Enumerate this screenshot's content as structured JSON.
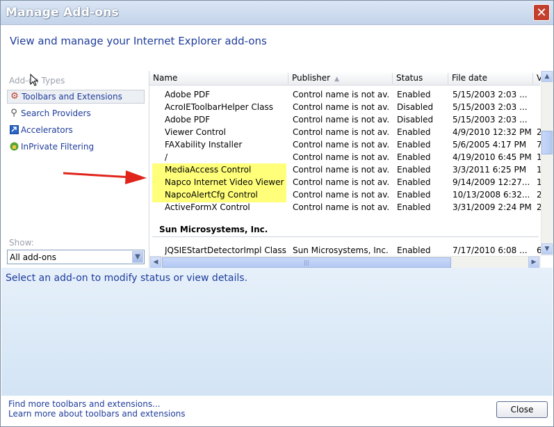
{
  "window": {
    "title": "Manage Add-ons",
    "close_glyph": "✕"
  },
  "header": {
    "heading": "View and manage your Internet Explorer add-ons"
  },
  "sidebar": {
    "types_label": "Add-on Types",
    "items": [
      {
        "label": "Toolbars and Extensions",
        "icon": "gear-icon",
        "selected": true
      },
      {
        "label": "Search Providers",
        "icon": "search-icon",
        "selected": false
      },
      {
        "label": "Accelerators",
        "icon": "accelerator-icon",
        "selected": false
      },
      {
        "label": "InPrivate Filtering",
        "icon": "inprivate-icon",
        "selected": false
      }
    ],
    "show_label": "Show:",
    "show_value": "All add-ons"
  },
  "grid": {
    "columns": [
      "Name",
      "Publisher",
      "Status",
      "File date",
      "V"
    ],
    "rows": [
      {
        "name": "Adobe PDF",
        "publisher": "Control name is not av...",
        "status": "Enabled",
        "date": "5/15/2003 2:03 ...",
        "v": ""
      },
      {
        "name": "AcroIEToolbarHelper Class",
        "publisher": "Control name is not av...",
        "status": "Disabled",
        "date": "5/15/2003 2:03 ...",
        "v": ""
      },
      {
        "name": "Adobe PDF",
        "publisher": "Control name is not av...",
        "status": "Disabled",
        "date": "5/15/2003 2:03 ...",
        "v": ""
      },
      {
        "name": "Viewer Control",
        "publisher": "Control name is not av...",
        "status": "Enabled",
        "date": "4/9/2010 12:32 PM",
        "v": "2"
      },
      {
        "name": "FAXability Installer",
        "publisher": "Control name is not av...",
        "status": "Enabled",
        "date": "5/6/2005 4:17 PM",
        "v": "7"
      },
      {
        "name": "/",
        "publisher": "Control name is not av...",
        "status": "Enabled",
        "date": "4/19/2010 6:45 PM",
        "v": "1"
      },
      {
        "name": "MediaAccess  Control",
        "publisher": "Control name is not av...",
        "status": "Enabled",
        "date": "3/3/2011 6:25 PM",
        "v": "1"
      },
      {
        "name": "Napco Internet Video Viewer",
        "publisher": "Control name is not av...",
        "status": "Enabled",
        "date": "9/14/2009 12:27...",
        "v": "1"
      },
      {
        "name": "NapcoAlertCfg Control",
        "publisher": "Control name is not av...",
        "status": "Enabled",
        "date": "10/13/2008 6:32...",
        "v": "2"
      },
      {
        "name": "ActiveFormX Control",
        "publisher": "Control name is not av...",
        "status": "Enabled",
        "date": "3/31/2009 2:24 PM",
        "v": "2"
      }
    ],
    "group_label": "Sun Microsystems, Inc.",
    "group_rows": [
      {
        "name": "JQSIEStartDetectorImpl Class",
        "publisher": "Sun Microsystems, Inc.",
        "status": "Enabled",
        "date": "7/17/2010 6:08 ...",
        "v": "6"
      }
    ],
    "highlight_color": "#ffff7a"
  },
  "details": {
    "text": "Select an add-on to modify status or view details."
  },
  "footer": {
    "link1": "Find more toolbars and extensions...",
    "link2": "Learn more about toolbars and extensions",
    "close_label": "Close"
  },
  "annotation": {
    "arrow_color": "#e0241b"
  }
}
